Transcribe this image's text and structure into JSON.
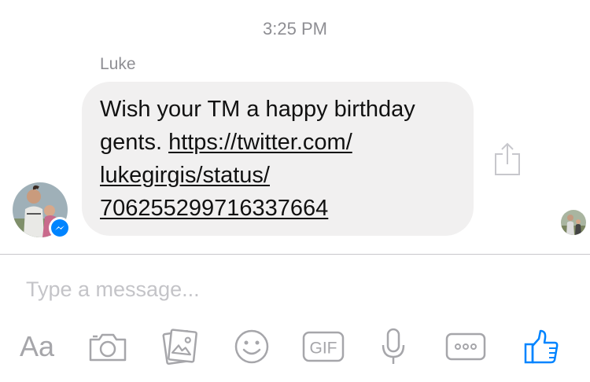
{
  "thread": {
    "timestamp": "3:25 PM",
    "sender": "Luke",
    "message": {
      "text_prefix": "Wish your TM a happy birthday gents. ",
      "link_line_1": "https://twitter.com/",
      "link_line_2": "lukegirgis/status/",
      "link_line_3": "706255299716337664"
    }
  },
  "composer": {
    "placeholder": "Type a message..."
  },
  "toolbar": {
    "text_format_label": "Aa",
    "gif_label": "GIF",
    "icons": [
      "text-format-icon",
      "camera-icon",
      "photo-gallery-icon",
      "emoji-icon",
      "gif-icon",
      "microphone-icon",
      "more-icon",
      "thumbs-up-icon"
    ]
  },
  "colors": {
    "accent": "#0084ff",
    "bubble": "#f1f0f0",
    "icon_gray": "#a6a6aa",
    "meta_gray": "#8e8e93"
  }
}
